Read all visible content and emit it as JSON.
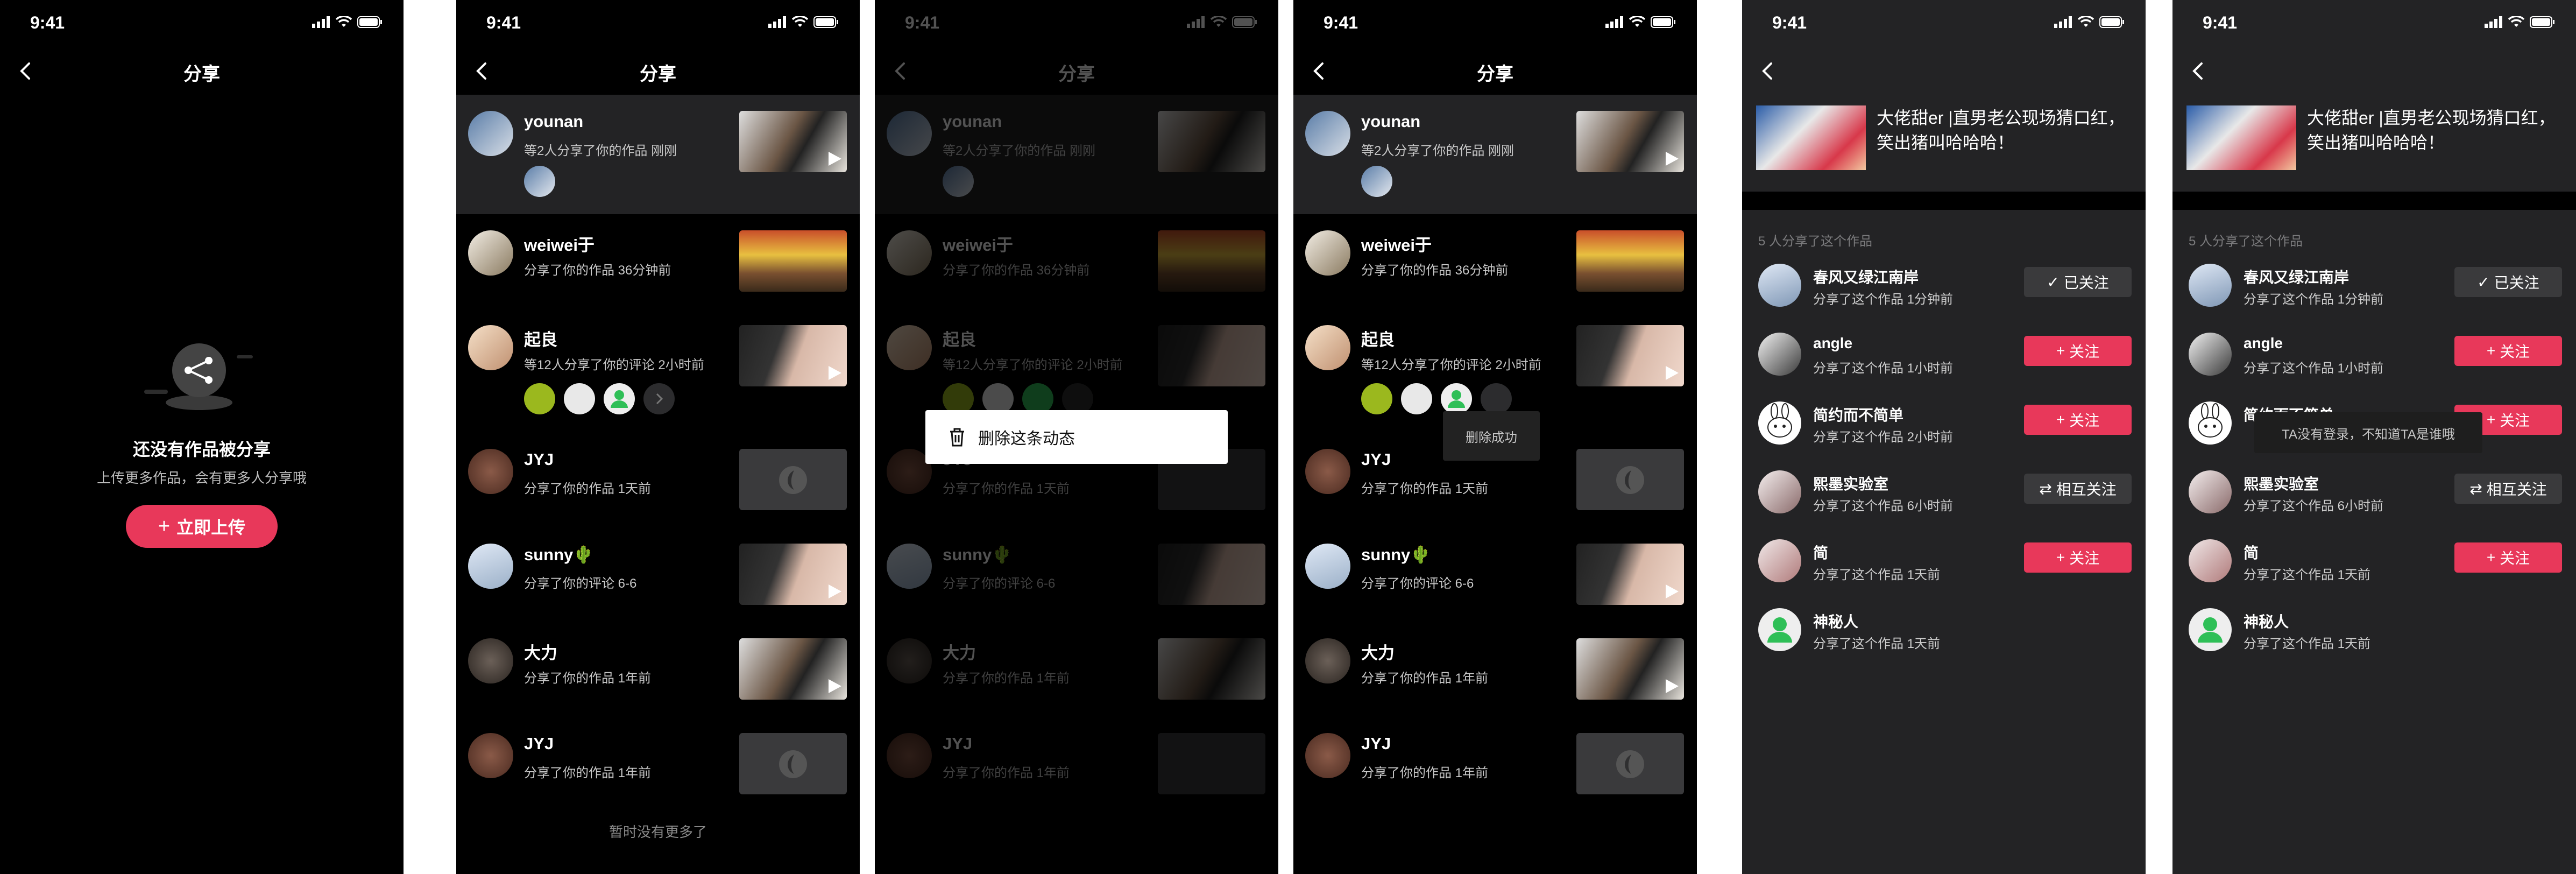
{
  "status_time": "9:41",
  "screens": {
    "empty": {
      "title": "分享",
      "empty_title": "还没有作品被分享",
      "empty_sub": "上传更多作品，会有更多人分享哦",
      "upload_button": "立即上传"
    },
    "list": {
      "title": "分享",
      "items": [
        {
          "name": "younan",
          "sub": "等2人分享了你的作品   刚刚"
        },
        {
          "name": "weiwei于",
          "sub": "分享了你的作品   36分钟前"
        },
        {
          "name": "起良",
          "sub": "等12人分享了你的评论   2小时前"
        },
        {
          "name": "JYJ",
          "sub": "分享了你的作品   1天前"
        },
        {
          "name": "sunny🌵",
          "sub": "分享了你的评论   6-6"
        },
        {
          "name": "大力",
          "sub": "分享了你的作品   1年前"
        },
        {
          "name": "JYJ",
          "sub": "分享了你的作品   1年前"
        }
      ],
      "footer": "暂时没有更多了"
    },
    "delete_menu": {
      "title": "分享",
      "menu_item": "删除这条动态"
    },
    "deleted": {
      "title": "分享",
      "toast": "删除成功"
    },
    "video": {
      "video_title": "大佬甜er |直男老公现场猜口红，笑出猪叫哈哈哈！",
      "section_caption": "5 人分享了这个作品",
      "followers": [
        {
          "name": "春风又绿江南岸",
          "sub": "分享了这个作品   1分钟前",
          "button": "已关注",
          "style": "grey",
          "icon": "check"
        },
        {
          "name": "angle",
          "sub": "分享了这个作品   1小时前",
          "button": "关注",
          "style": "red",
          "icon": "plus"
        },
        {
          "name": "简约而不简单",
          "sub": "分享了这个作品   2小时前",
          "button": "关注",
          "style": "red",
          "icon": "plus"
        },
        {
          "name": "熙墨实验室",
          "sub": "分享了这个作品   6小时前",
          "button": "相互关注",
          "style": "grey",
          "icon": "swap"
        },
        {
          "name": "简",
          "sub": "分享了这个作品   1天前",
          "button": "关注",
          "style": "red",
          "icon": "plus"
        },
        {
          "name": "神秘人",
          "sub": "分享了这个作品   1天前",
          "button": "",
          "style": "none",
          "icon": ""
        }
      ],
      "toast": "TA没有登录，不知道TA是谁哦"
    }
  }
}
